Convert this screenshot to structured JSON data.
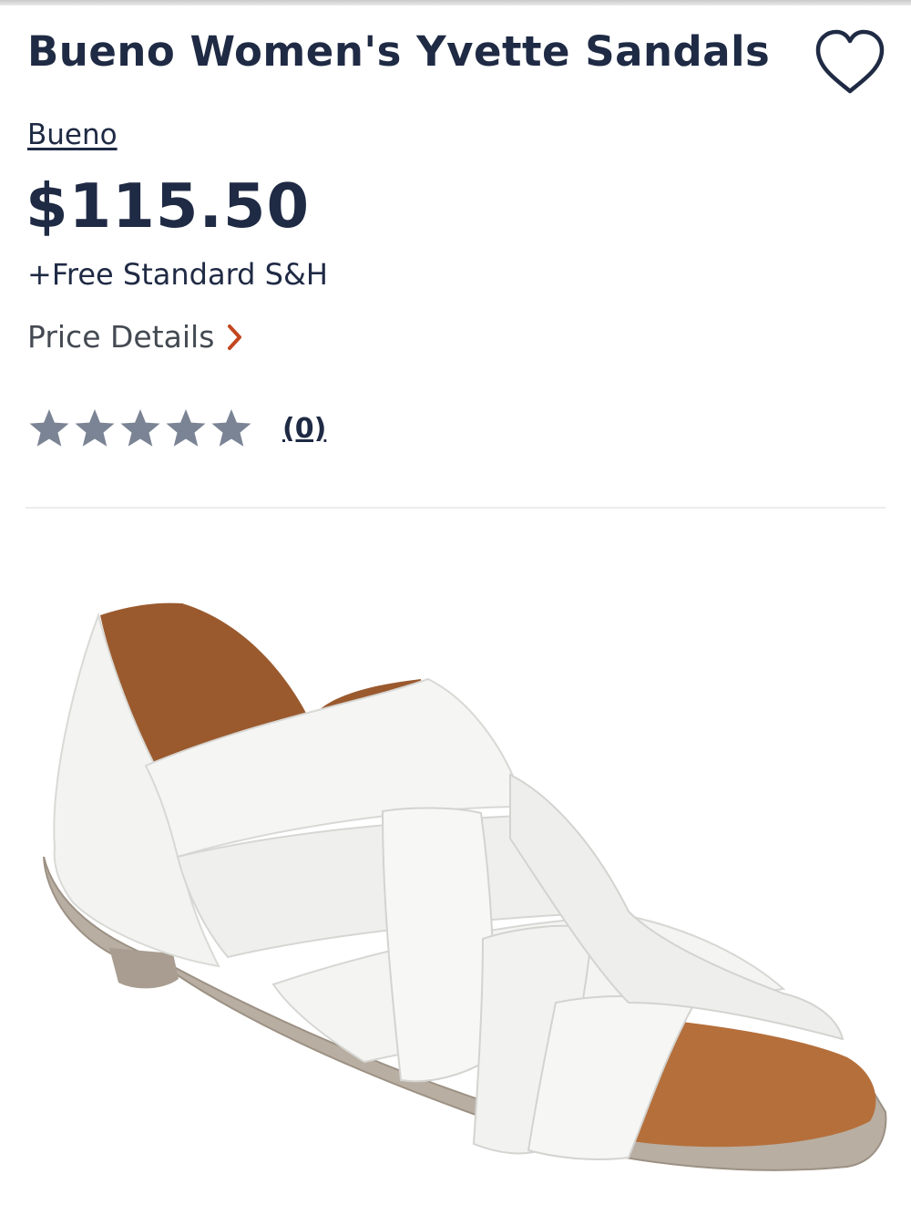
{
  "product": {
    "title": "Bueno Women's Yvette Sandals",
    "brand": "Bueno",
    "price": "$115.50",
    "shipping": "+Free Standard S&H",
    "price_details_label": "Price Details",
    "rating": {
      "stars": 0,
      "max_stars": 5,
      "review_count": "(0)"
    },
    "image_subject": "white woven leather sandal with brown lining"
  },
  "icons": {
    "favorite": "heart-icon",
    "price_details": "chevron-right-icon",
    "rating": "star-icon"
  },
  "colors": {
    "text_primary": "#1f2a44",
    "text_secondary": "#444a52",
    "chevron_accent": "#c2461f",
    "star_empty": "#7b8494",
    "divider": "#ececec"
  }
}
